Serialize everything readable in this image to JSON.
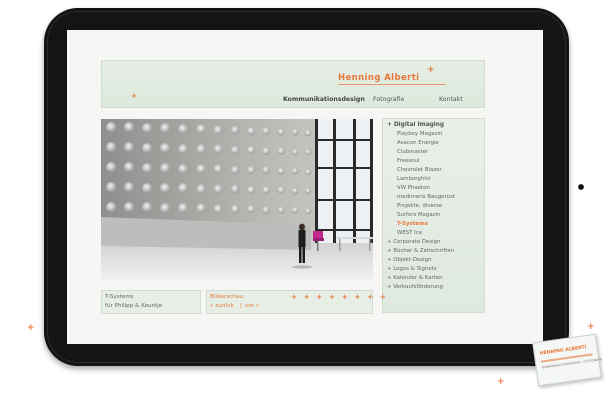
{
  "site": {
    "brand": "Henning Alberti"
  },
  "nav": {
    "items": [
      {
        "label": "Kommunikationsdesign",
        "active": true
      },
      {
        "label": "Fotografie",
        "active": false
      },
      {
        "label": "Kontakt",
        "active": false
      }
    ]
  },
  "sidebar": {
    "heading": "+ Digital Imaging",
    "sub_items": [
      "Playboy Magazin",
      "Avacon Energie",
      "Clubmaster",
      "Freesoul",
      "Chevrolet Blazer",
      "Lamborghini",
      "VW Phaeton",
      "medimeris Baugerüst",
      "Projekte, diverse",
      "Surfers Magazin",
      "T-Systems",
      "WEST Ice"
    ],
    "active_sub": "T-Systems",
    "categories": [
      "+ Corporate Design",
      "+ Bücher & Zeitschriften",
      "+ Objekt-Design",
      "+ Logos & Signets",
      "+ Kalender & Karten",
      "+ Verkaufsförderung"
    ]
  },
  "caption": {
    "line1": "T-Systems",
    "line2": "für Philipp & Keuntje"
  },
  "slideshow": {
    "label": "Bilderschau",
    "prev": "« zurück",
    "separator": "|",
    "next": "vor »",
    "dots": "+ + + + + + + +"
  },
  "card": {
    "name": "HENNING ALBERTI",
    "sub": "KOMMUNIKATIONSDESIGN · FOTOGRAFIE"
  },
  "colors": {
    "accent": "#e8773a",
    "panel": "#e6eee5",
    "bezel": "#141414"
  },
  "icons": {
    "decor": "plus-sparkle-icon"
  }
}
